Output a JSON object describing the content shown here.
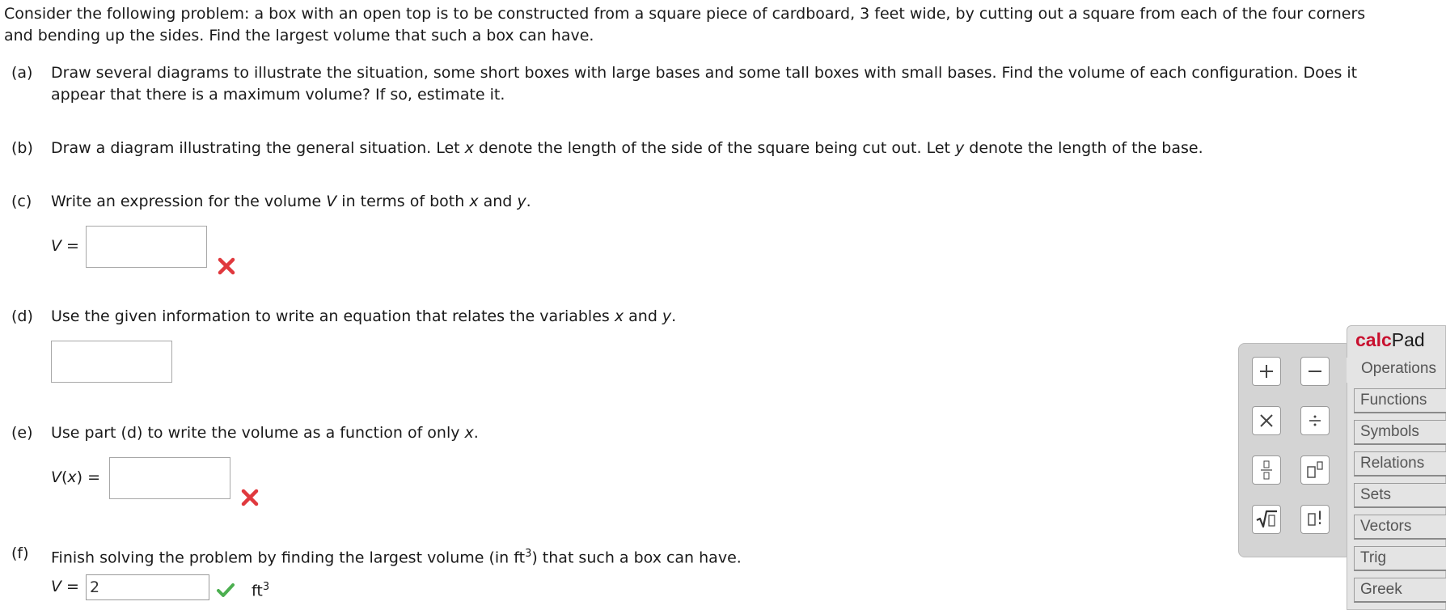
{
  "intro": "Consider the following problem: a box with an open top is to be constructed from a square piece of cardboard, 3 feet wide, by cutting out a square from each of the four corners and bending up the sides. Find the largest volume that such a box can have.",
  "parts": {
    "a": {
      "letter": "(a)",
      "text": "Draw several diagrams to illustrate the situation, some short boxes with large bases and some tall boxes with small bases. Find the volume of each configuration. Does it appear that there is a maximum volume? If so, estimate it."
    },
    "b": {
      "letter": "(b)",
      "text_1": "Draw a diagram illustrating the general situation. Let ",
      "var_x": "x",
      "text_2": " denote the length of the side of the square being cut out. Let ",
      "var_y": "y",
      "text_3": " denote the length of the base."
    },
    "c": {
      "letter": "(c)",
      "text_1": "Write an expression for the volume ",
      "var_v": "V",
      "text_2": " in terms of both ",
      "var_x": "x",
      "text_3": " and ",
      "var_y": "y",
      "text_4": ".",
      "answer_var": "V",
      "answer_eq": " =",
      "answer_value": "",
      "status": "incorrect"
    },
    "d": {
      "letter": "(d)",
      "text_1": "Use the given information to write an equation that relates the variables ",
      "var_x": "x",
      "text_2": " and ",
      "var_y": "y",
      "text_3": ".",
      "answer_value": ""
    },
    "e": {
      "letter": "(e)",
      "text_1": "Use part (d) to write the volume as a function of only ",
      "var_x": "x",
      "text_2": ".",
      "answer_var": "V",
      "answer_paren_open": "(",
      "answer_arg": "x",
      "answer_paren_close": ")",
      "answer_eq": " =",
      "answer_value": "",
      "status": "incorrect"
    },
    "f": {
      "letter": "(f)",
      "text_1": "Finish solving the problem by finding the largest volume (in ft",
      "sup": "3",
      "text_2": ") that such a box can have.",
      "answer_var": "V",
      "answer_eq": " =",
      "answer_value": "2",
      "status": "correct",
      "unit": "ft",
      "unit_sup": "3"
    }
  },
  "calcpad": {
    "title_brand": "calc",
    "title_rest": "Pad",
    "buttons": [
      "plus-button",
      "minus-button",
      "times-button",
      "divide-button",
      "fraction-button",
      "exponent-button",
      "sqrt-button",
      "factorial-button"
    ],
    "factorial_glyph": "!",
    "tabs": [
      "Operations",
      "Functions",
      "Symbols",
      "Relations",
      "Sets",
      "Vectors",
      "Trig",
      "Greek"
    ],
    "active_tab": "Operations"
  },
  "colors": {
    "text": "#1a1a1a",
    "incorrect": "#e0393e",
    "correct": "#4caf50",
    "brand": "#c8102e",
    "panel": "#d4d4d4",
    "tabs_bg": "#e4e4e4"
  }
}
